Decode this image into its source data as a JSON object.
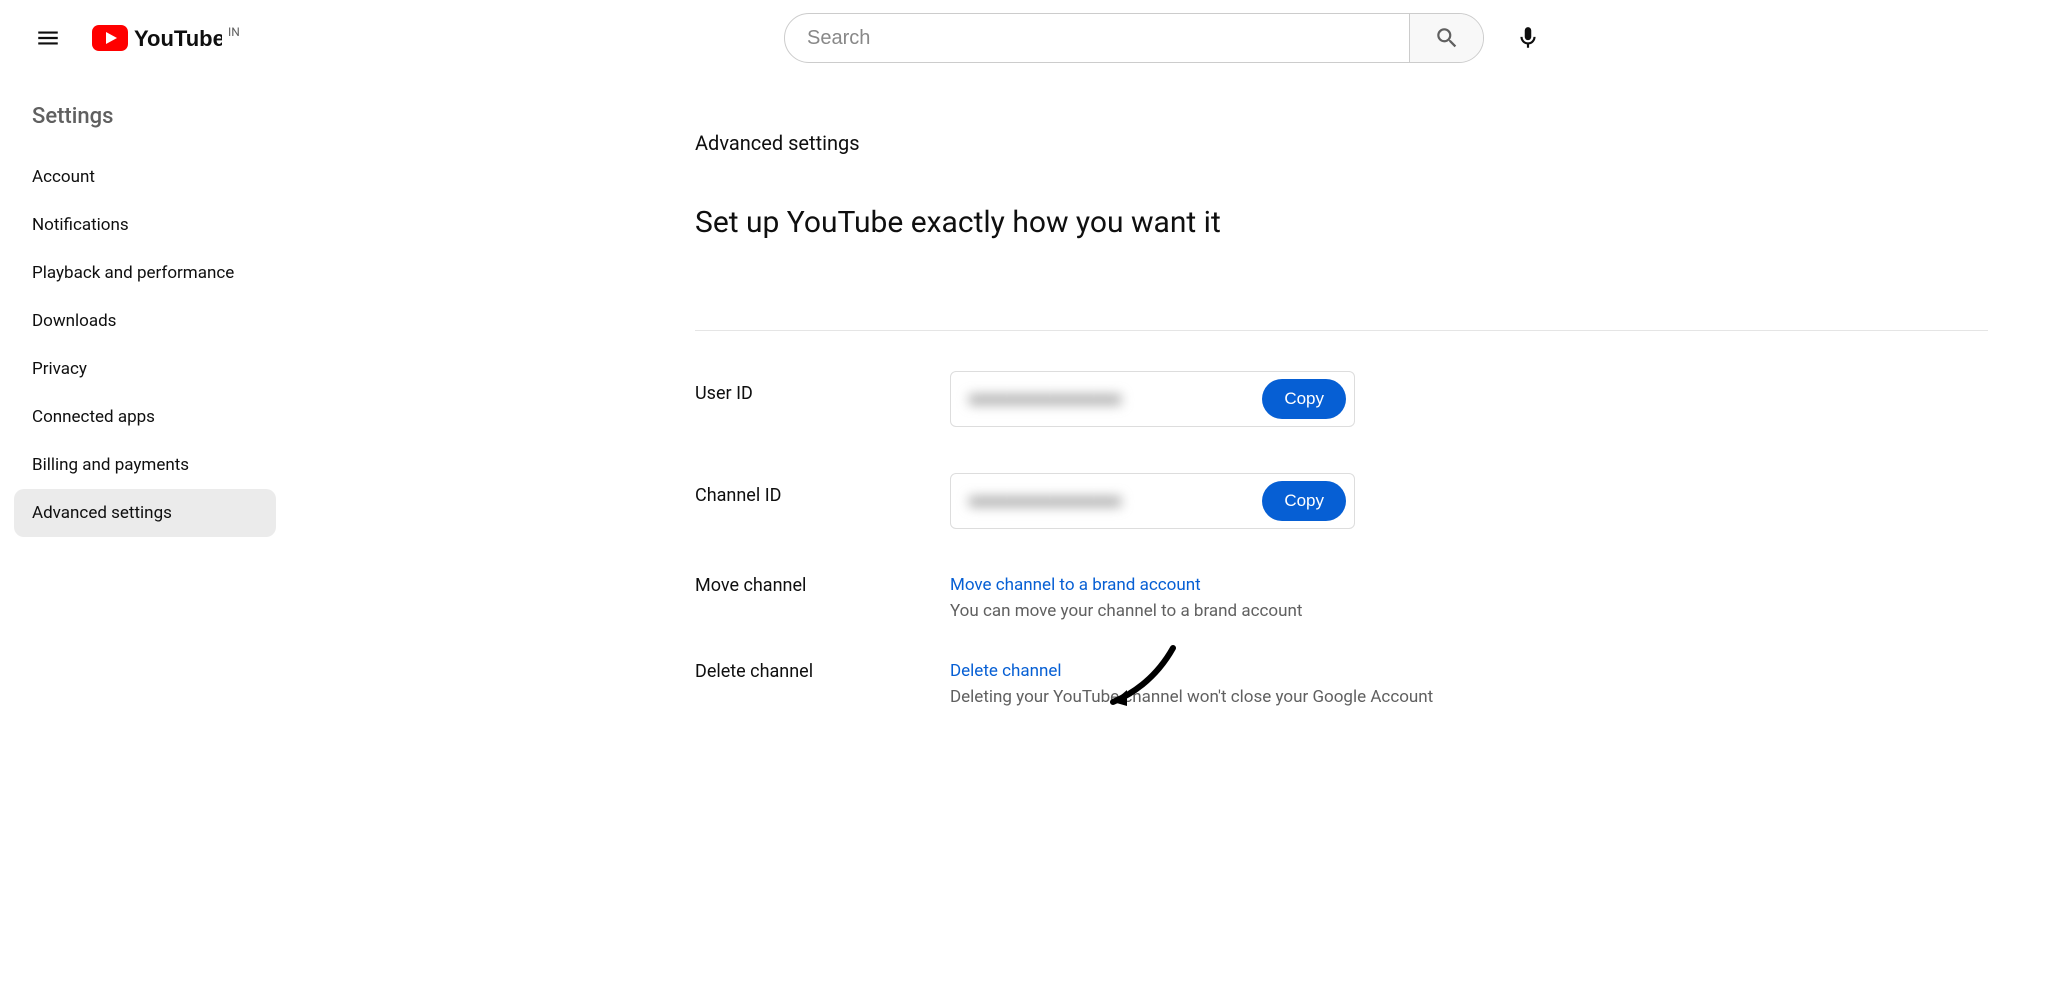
{
  "header": {
    "logo_text": "YouTube",
    "country_code": "IN",
    "search_placeholder": "Search"
  },
  "sidebar": {
    "title": "Settings",
    "items": [
      {
        "label": "Account"
      },
      {
        "label": "Notifications"
      },
      {
        "label": "Playback and performance"
      },
      {
        "label": "Downloads"
      },
      {
        "label": "Privacy"
      },
      {
        "label": "Connected apps"
      },
      {
        "label": "Billing and payments"
      },
      {
        "label": "Advanced settings"
      }
    ]
  },
  "main": {
    "title": "Advanced settings",
    "heading": "Set up YouTube exactly how you want it",
    "user_id_label": "User ID",
    "user_id_value": "■■■■■■■■■■■■■■",
    "user_id_copy": "Copy",
    "channel_id_label": "Channel ID",
    "channel_id_value": "■■■■■■■■■■■■■■",
    "channel_id_copy": "Copy",
    "move_label": "Move channel",
    "move_link": "Move channel to a brand account",
    "move_sub": "You can move your channel to a brand account",
    "delete_label": "Delete channel",
    "delete_link": "Delete channel",
    "delete_sub": "Deleting your YouTube channel won't close your Google Account"
  }
}
